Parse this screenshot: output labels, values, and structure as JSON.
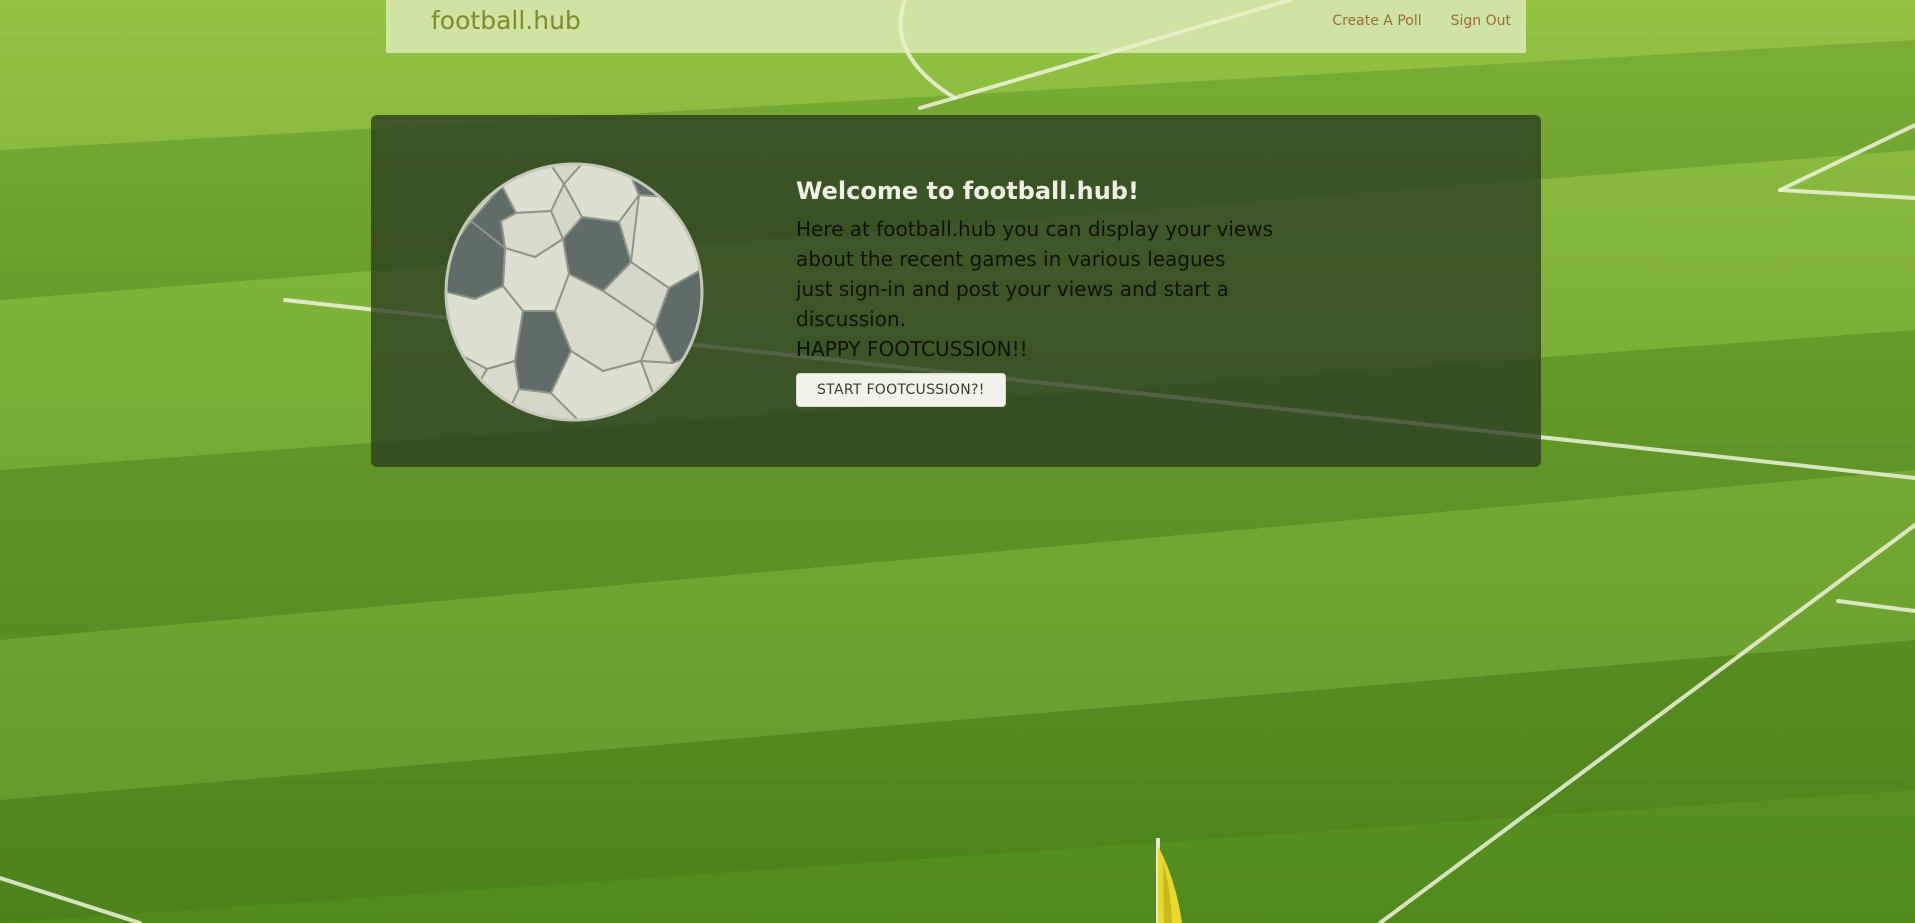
{
  "navbar": {
    "brand": "football.hub",
    "links": [
      {
        "label": "Create A Poll"
      },
      {
        "label": "Sign Out"
      }
    ]
  },
  "jumbotron": {
    "title": "Welcome to football.hub!",
    "lines": [
      "Here at football.hub you can display your views about the recent games in various leagues",
      "just sign-in and post your views and start a discussion.",
      "HAPPY FOOTCUSSION!!"
    ],
    "button_label": "START FOOTCUSSION?!"
  },
  "colors": {
    "grass": "#5f9a26",
    "navbar_bg": "#e8f0c8",
    "brand": "#7f8a2a",
    "nav_link": "#9a6a3c",
    "panel_bg": "#2c3c20",
    "panel_title": "#f0f0e4",
    "panel_text": "#101308",
    "button_bg": "#f2f2ea"
  },
  "icons": {
    "hero": "soccer-ball-icon",
    "corner": "corner-flag-icon"
  }
}
